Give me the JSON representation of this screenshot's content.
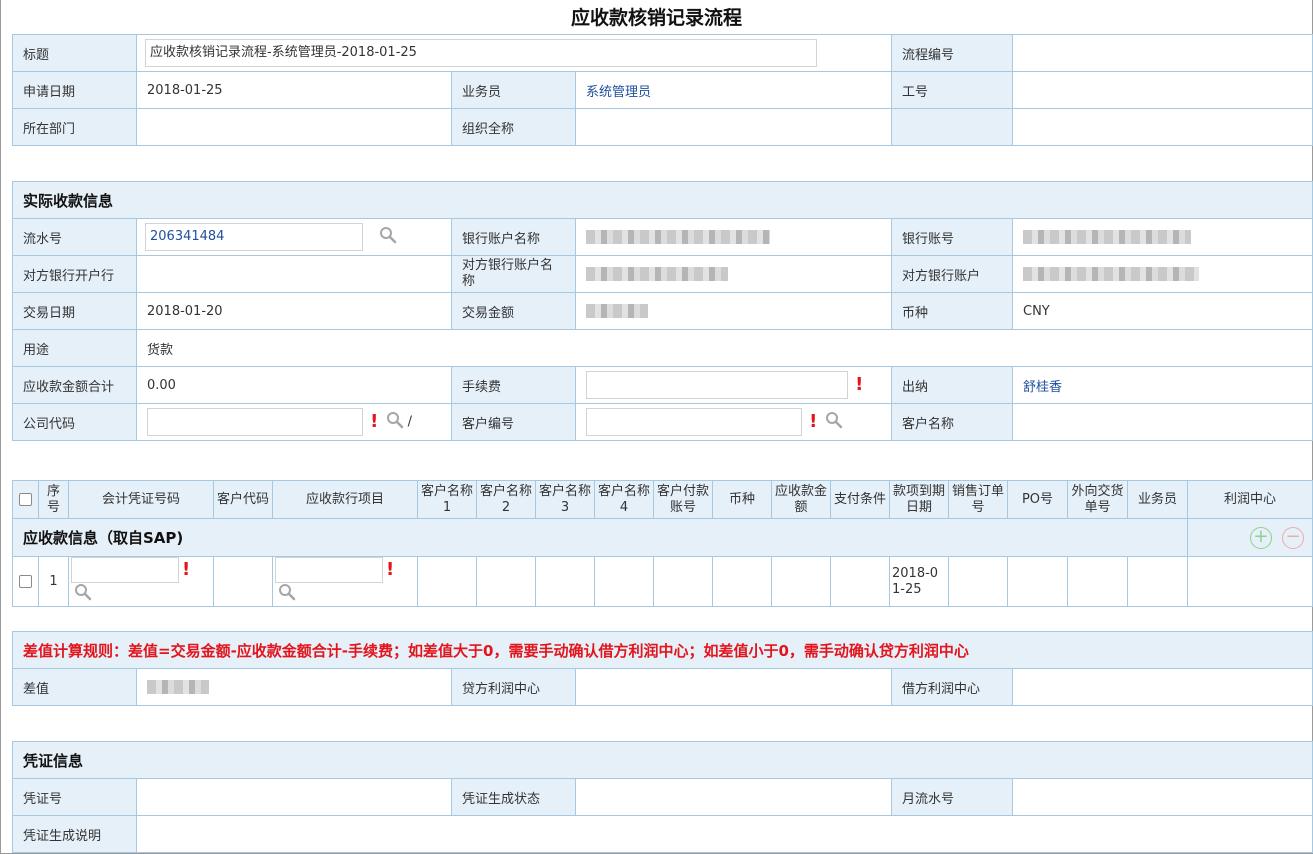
{
  "page": {
    "title": "应收款核销记录流程"
  },
  "header": {
    "title_label": "标题",
    "title_value": "应收款核销记录流程-系统管理员-2018-01-25",
    "flow_no_label": "流程编号",
    "flow_no_value": "",
    "apply_date_label": "申请日期",
    "apply_date_value": "2018-01-25",
    "salesman_label": "业务员",
    "salesman_value": "系统管理员",
    "job_no_label": "工号",
    "job_no_value": "",
    "dept_label": "所在部门",
    "dept_value": "",
    "org_label": "组织全称",
    "org_value": ""
  },
  "receipt": {
    "section_title": "实际收款信息",
    "serial_label": "流水号",
    "serial_value": "206341484",
    "bank_account_name_label": "银行账户名称",
    "bank_account_no_label": "银行账号",
    "counter_bank_label": "对方银行开户行",
    "counter_bank_value": "",
    "counter_account_name_label": "对方银行账户名称",
    "counter_account_label": "对方银行账户",
    "trade_date_label": "交易日期",
    "trade_date_value": "2018-01-20",
    "trade_amount_label": "交易金额",
    "currency_label": "币种",
    "currency_value": "CNY",
    "purpose_label": "用途",
    "purpose_value": "货款",
    "receivable_total_label": "应收款金额合计",
    "receivable_total_value": "0.00",
    "fee_label": "手续费",
    "fee_value": "",
    "cashier_label": "出纳",
    "cashier_value": "舒桂香",
    "company_code_label": "公司代码",
    "company_code_value": "",
    "company_sep": "/",
    "customer_no_label": "客户编号",
    "customer_no_value": "",
    "customer_name_label": "客户名称",
    "customer_name_value": ""
  },
  "receivables": {
    "section_title": "应收款信息（取自SAP)",
    "columns": [
      "",
      "序号",
      "会计凭证号码",
      "客户代码",
      "应收款行项目",
      "客户名称1",
      "客户名称2",
      "客户名称3",
      "客户名称4",
      "客户付款账号",
      "币种",
      "应收款金额",
      "支付条件",
      "款项到期日期",
      "销售订单号",
      "PO号",
      "外向交货单号",
      "业务员",
      "利润中心"
    ],
    "rows": [
      {
        "seq": "1",
        "voucher_no": "",
        "customer_code": "",
        "line_item": "",
        "due_date": "2018-01-25"
      }
    ],
    "add_label": "+",
    "remove_label": "−"
  },
  "difference": {
    "rule_text": "差值计算规则：差值=交易金额-应收款金额合计-手续费；如差值大于0，需要手动确认借方利润中心；如差值小于0，需手动确认贷方利润中心",
    "diff_label": "差值",
    "credit_profit_label": "贷方利润中心",
    "credit_profit_value": "",
    "debit_profit_label": "借方利润中心",
    "debit_profit_value": ""
  },
  "voucher": {
    "section_title": "凭证信息",
    "voucher_no_label": "凭证号",
    "voucher_no_value": "",
    "status_label": "凭证生成状态",
    "status_value": "",
    "monthly_serial_label": "月流水号",
    "monthly_serial_value": "",
    "desc_label": "凭证生成说明",
    "desc_value": ""
  },
  "colors": {
    "label_bg": "#e6f0f9",
    "border": "#a6c8e0",
    "link_blue": "#1f4f9e",
    "required_red": "#e3141b"
  },
  "icons": {
    "search": "search-icon",
    "required": "required-mark-icon",
    "add": "add-row-icon",
    "remove": "remove-row-icon"
  }
}
